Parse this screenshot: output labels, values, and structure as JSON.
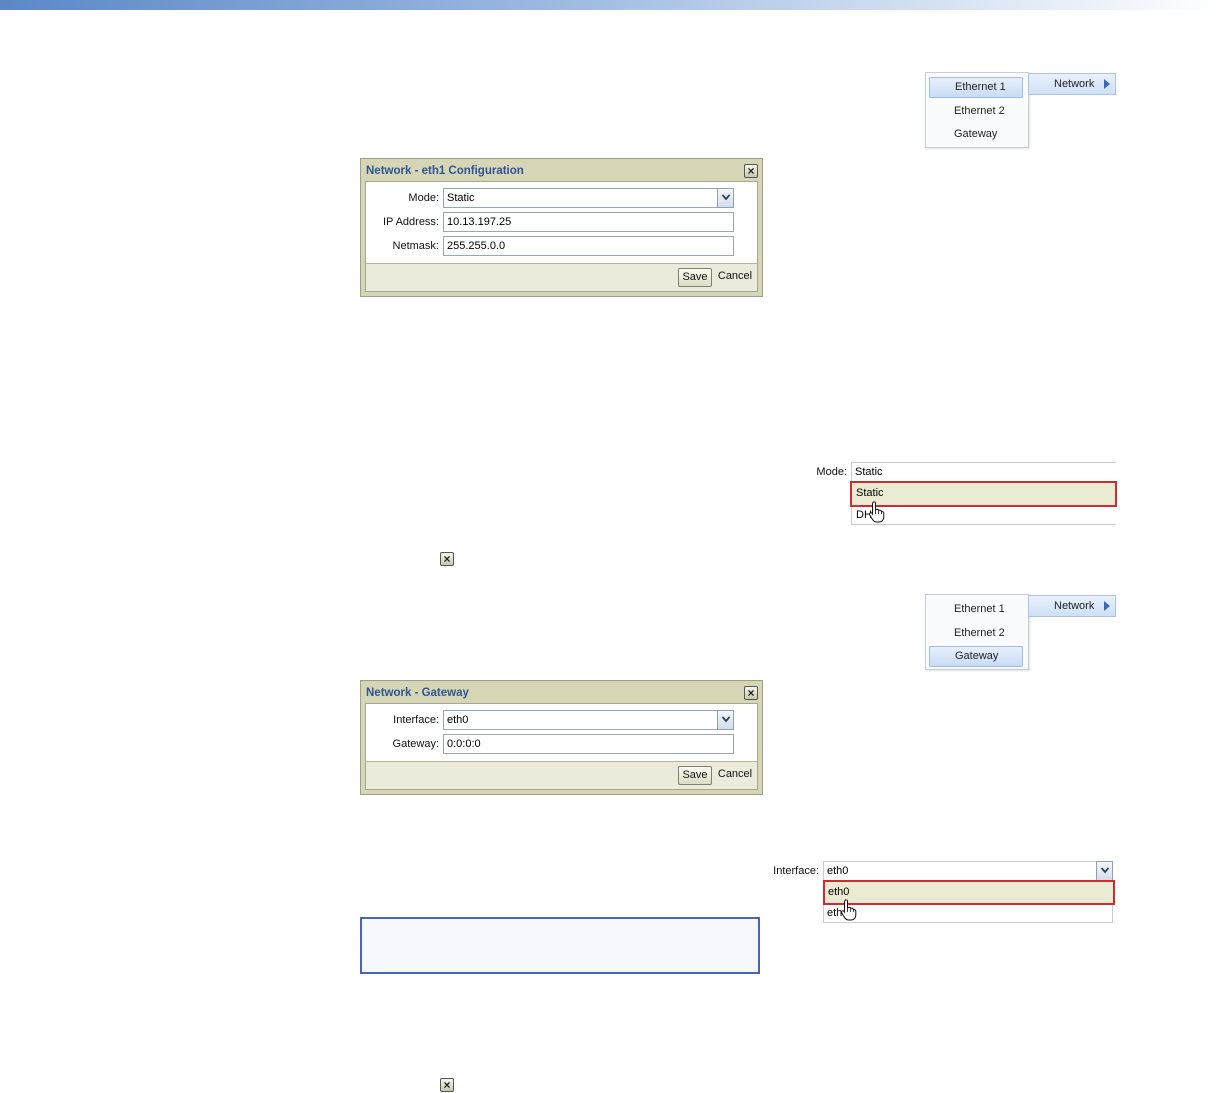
{
  "menu_top": {
    "root_label": "Network",
    "items": [
      {
        "label": "Ethernet 1",
        "selected": true
      },
      {
        "label": "Ethernet 2",
        "selected": false
      },
      {
        "label": "Gateway",
        "selected": false
      }
    ]
  },
  "dialog_eth1": {
    "title": "Network - eth1 Configuration",
    "mode_label": "Mode:",
    "mode_value": "Static",
    "ip_label": "IP Address:",
    "ip_value": "10.13.197.25",
    "netmask_label": "Netmask:",
    "netmask_value": "255.255.0.0",
    "save_label": "Save",
    "cancel_label": "Cancel"
  },
  "mode_dropdown": {
    "label": "Mode:",
    "value": "Static",
    "options": [
      "Static",
      "DH"
    ]
  },
  "menu_bottom": {
    "root_label": "Network",
    "items": [
      {
        "label": "Ethernet 1",
        "selected": false
      },
      {
        "label": "Ethernet 2",
        "selected": false
      },
      {
        "label": "Gateway",
        "selected": true
      }
    ]
  },
  "dialog_gateway": {
    "title": "Network - Gateway",
    "interface_label": "Interface:",
    "interface_value": "eth0",
    "gateway_label": "Gateway:",
    "gateway_value": "0:0:0:0",
    "save_label": "Save",
    "cancel_label": "Cancel"
  },
  "interface_dropdown": {
    "label": "Interface:",
    "value": "eth0",
    "options": [
      "eth0",
      "eth"
    ]
  },
  "icons": {
    "close": "close-icon",
    "combo": "chevron-down-icon",
    "submenu": "chevron-right-icon",
    "pointer": "hand-pointer-icon"
  },
  "colors": {
    "dialog_frame": "#d6d6b6",
    "title_text": "#2f5592",
    "selected_menu": "#c8dcf5",
    "highlight_border": "#d32a32",
    "note_border": "#4b63b8"
  }
}
